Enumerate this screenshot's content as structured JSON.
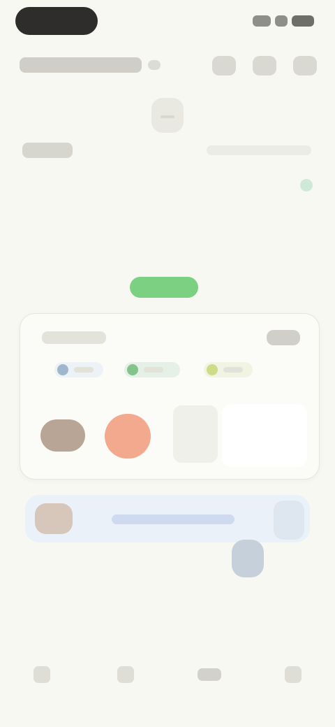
{
  "status_bar": {
    "left": "",
    "right": ""
  },
  "header": {
    "title": "",
    "icons": [
      {
        "name": "search-icon"
      },
      {
        "name": "calendar-icon"
      },
      {
        "name": "more-icon"
      }
    ]
  },
  "date_strip": {
    "days": [
      {
        "label": "",
        "active": false
      },
      {
        "label": "",
        "active": false
      },
      {
        "label": "",
        "active": false
      },
      {
        "label": "",
        "active": true
      },
      {
        "label": "",
        "active": false
      },
      {
        "label": "",
        "active": false
      },
      {
        "label": "",
        "active": false
      }
    ]
  },
  "section": {
    "label": "",
    "right_text": ""
  },
  "cta": {
    "label": ""
  },
  "card": {
    "title": "",
    "action": "",
    "chips": [
      {
        "label": "",
        "color": "#9fb6cf"
      },
      {
        "label": "",
        "color": "#82c48b"
      },
      {
        "label": "",
        "color": "#d0db8a"
      }
    ]
  },
  "banner": {
    "text": ""
  },
  "bottom_nav": [
    {
      "label": "",
      "icon": "home-icon"
    },
    {
      "label": "",
      "icon": "list-icon"
    },
    {
      "label": "",
      "icon": "stats-icon"
    },
    {
      "label": "",
      "icon": "profile-icon"
    }
  ],
  "colors": {
    "background": "#f8f8f2",
    "accent": "#7bd082",
    "status_pill": "#2e2d2b"
  }
}
